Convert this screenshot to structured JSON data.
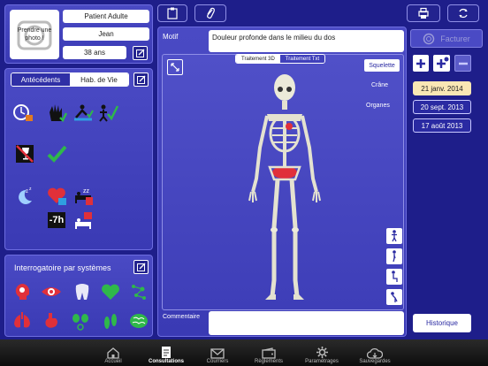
{
  "patient": {
    "photo_label": "Prendre une photo !",
    "type": "Patient Adulte",
    "name": "Jean",
    "age": "38 ans"
  },
  "history": {
    "tabs": [
      "Antécédents",
      "Hab. de Vie"
    ],
    "selected_tab": "Hab. de Vie",
    "icons": [
      "time-dial-icon",
      "hand-glove-icon",
      "person-rowing-icon",
      "person-checkmark-icon",
      "wine-glass-icon",
      "checkmark-icon",
      "sleep-moon-icon",
      "heart-pink-icon",
      "bed-zzz-icon",
      "minus-7h-icon",
      "bed-alarm-icon"
    ],
    "sleep_label": "-7h"
  },
  "systems": {
    "title": "Interrogatoire par systèmes",
    "icons": [
      "brain-head-icon",
      "eye-icon",
      "tooth-icon",
      "heart-icon",
      "molecule-icon",
      "lungs-icon",
      "stomach-icon",
      "kidneys-icon",
      "feet-icon",
      "brain-icon"
    ]
  },
  "consultation": {
    "motif_label": "Motif",
    "motif_value": "Douleur profonde dans le milieu du dos",
    "view_tabs": [
      "Traitement 3D",
      "Traitement Txt"
    ],
    "selected_view": "Traitement 3D",
    "layers": [
      "Squelette",
      "Crâne",
      "Organes"
    ],
    "selected_layer": "Squelette",
    "comment_label": "Commentaire",
    "comment_value": ""
  },
  "actions": {
    "invoice_label": "Facturer",
    "history_label": "Historique"
  },
  "dates": [
    "21 janv. 2014",
    "20 sept. 2013",
    "17 août 2013"
  ],
  "selected_date": "21 janv. 2014",
  "tabbar": {
    "items": [
      "Accueil",
      "Consultations",
      "Courriers",
      "Règlements",
      "Paramétrages",
      "Sauvegardes"
    ],
    "selected": "Consultations"
  },
  "colors": {
    "background": "#1e1e8a",
    "panel": "#4040bb",
    "accent_red": "#e0303a",
    "accent_green": "#2fb84a",
    "selected_date": "#f9e7b4"
  }
}
